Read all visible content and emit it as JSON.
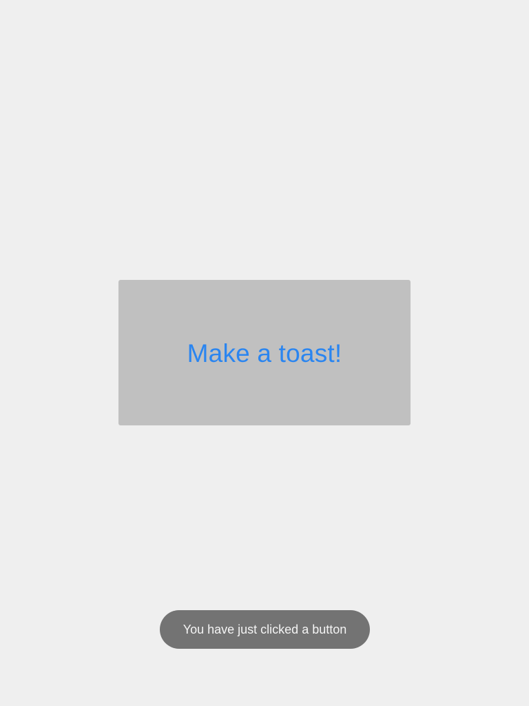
{
  "main": {
    "toast_button_label": "Make a toast!"
  },
  "toast": {
    "message": "You have just clicked a button"
  },
  "colors": {
    "background": "#efefef",
    "button_background": "#c0c0c0",
    "button_text": "#2a85f0",
    "toast_background": "#737373",
    "toast_text": "#f4f4f4"
  }
}
